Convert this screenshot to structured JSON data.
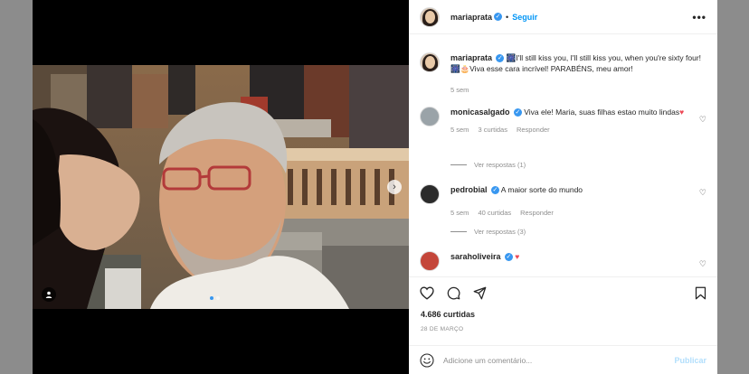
{
  "post": {
    "author": "mariaprata",
    "follow_label": "Seguir",
    "separator": "•",
    "more_label": "•••",
    "caption_text": "🎆I'll still kiss you, I'll still kiss you, when you're sixty four! 🎆🎂Viva esse cara incrível! PARABÉNS, meu amor!",
    "caption_time": "5 sem",
    "likes": "4.686 curtidas",
    "date": "28 DE MARÇO"
  },
  "comments": [
    {
      "username": "monicasalgado",
      "text": "Viva ele! Maria, suas filhas estao muito lindas",
      "emoji": "♥",
      "time": "5 sem",
      "likes": "3 curtidas",
      "reply": "Responder",
      "view_replies": "Ver respostas (1)"
    },
    {
      "username": "pedrobial",
      "text": "A maior sorte do mundo",
      "emoji": "",
      "time": "5 sem",
      "likes": "40 curtidas",
      "reply": "Responder",
      "view_replies": "Ver respostas (3)"
    },
    {
      "username": "saraholiveira",
      "text": "",
      "emoji": "♥",
      "time": "",
      "likes": "",
      "reply": "",
      "view_replies": ""
    }
  ],
  "composer": {
    "placeholder": "Adicione um comentário...",
    "publish_label": "Publicar"
  },
  "icons": {
    "like": "heart-outline-icon",
    "comment": "comment-icon",
    "share": "paper-plane-icon",
    "save": "bookmark-icon",
    "emoji": "smiley-icon",
    "next": "chevron-right-icon",
    "tag": "user-tag-icon"
  },
  "colors": {
    "accent": "#0095f6",
    "verified": "#3897f0",
    "heart": "#ed4956",
    "muted": "#8e8e8e"
  }
}
